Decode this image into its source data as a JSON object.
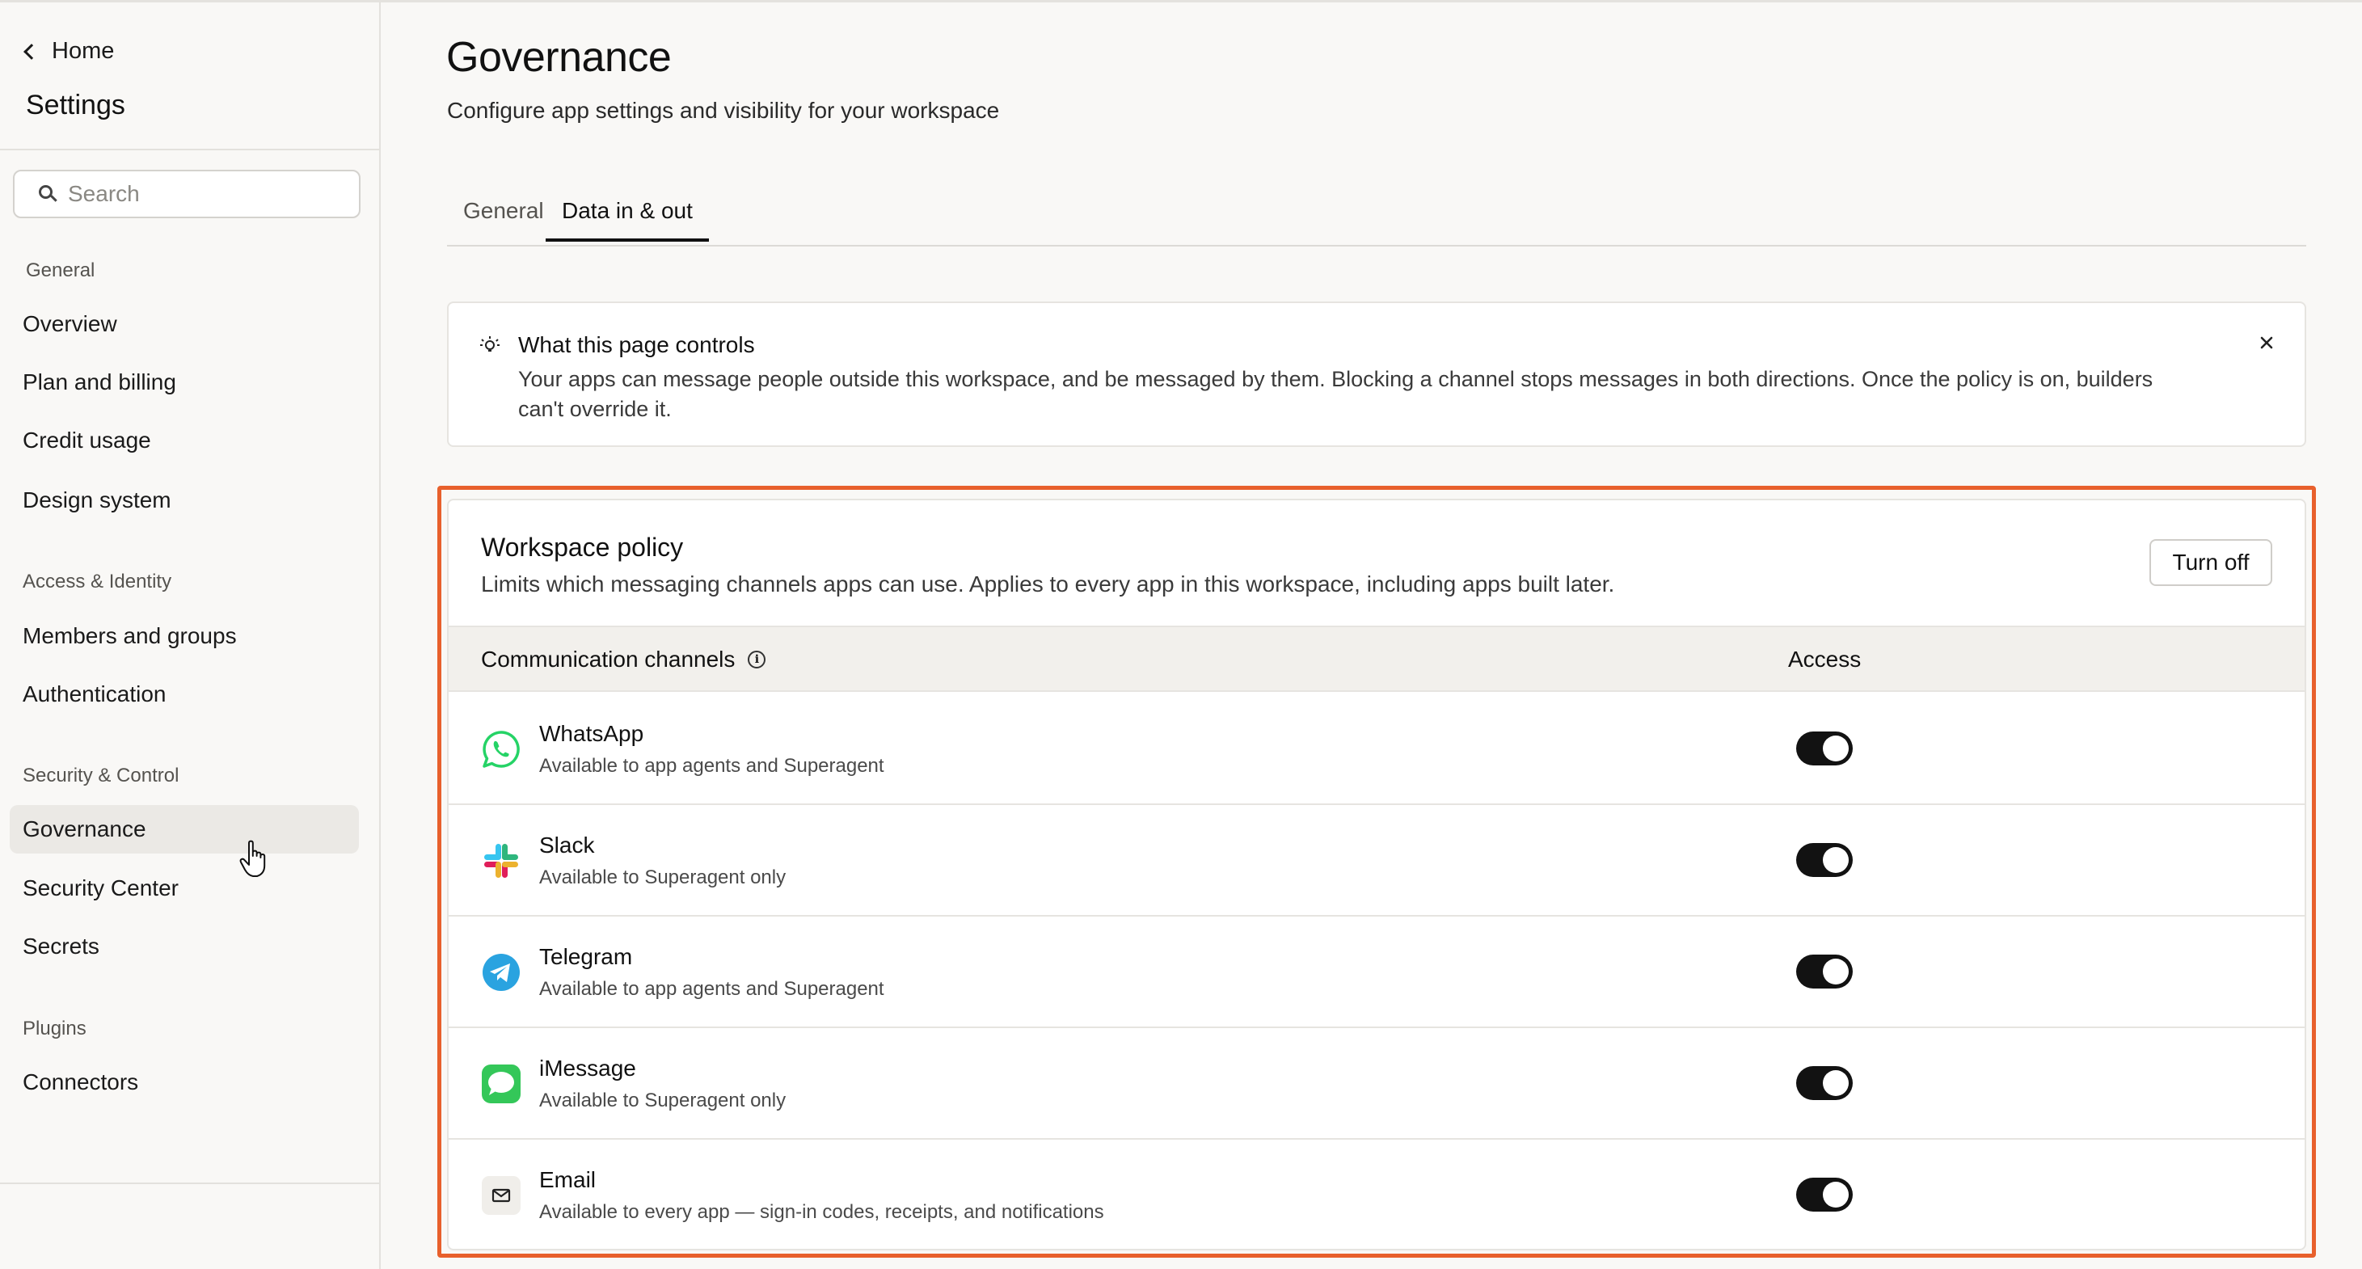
{
  "sidebar": {
    "home_label": "Home",
    "title": "Settings",
    "search_placeholder": "Search",
    "sections": [
      {
        "label": "General",
        "items": [
          "Overview",
          "Plan and billing",
          "Credit usage",
          "Design system"
        ]
      },
      {
        "label": "Access & Identity",
        "items": [
          "Members and groups",
          "Authentication"
        ]
      },
      {
        "label": "Security & Control",
        "items": [
          "Governance",
          "Security Center",
          "Secrets"
        ]
      },
      {
        "label": "Plugins",
        "items": [
          "Connectors"
        ]
      }
    ],
    "active_item": "Governance"
  },
  "header": {
    "title": "Governance",
    "subtitle": "Configure app settings and visibility for your workspace"
  },
  "tabs": [
    {
      "label": "General",
      "active": false
    },
    {
      "label": "Data in & out",
      "active": true
    }
  ],
  "info_box": {
    "title": "What this page controls",
    "body": "Your apps can message people outside this workspace, and be messaged by them. Blocking a channel stops messages in both directions. Once the policy is on, builders can't override it."
  },
  "policy": {
    "title": "Workspace policy",
    "description": "Limits which messaging channels apps can use. Applies to every app in this workspace, including apps built later.",
    "turn_off_label": "Turn off",
    "col_channels": "Communication channels",
    "col_access": "Access",
    "channels": [
      {
        "name": "WhatsApp",
        "sub": "Available to app agents and Superagent",
        "icon": "whatsapp-icon",
        "enabled": true
      },
      {
        "name": "Slack",
        "sub": "Available to Superagent only",
        "icon": "slack-icon",
        "enabled": true
      },
      {
        "name": "Telegram",
        "sub": "Available to app agents and Superagent",
        "icon": "telegram-icon",
        "enabled": true
      },
      {
        "name": "iMessage",
        "sub": "Available to Superagent only",
        "icon": "imessage-icon",
        "enabled": true
      },
      {
        "name": "Email",
        "sub": "Available to every app — sign-in codes, receipts, and notifications",
        "icon": "mail-icon",
        "enabled": true
      }
    ]
  },
  "colors": {
    "highlight": "#e8602c",
    "toggle_on": "#121212",
    "whatsapp": "#25d366",
    "telegram": "#2aa3e0",
    "imessage": "#34c759"
  }
}
